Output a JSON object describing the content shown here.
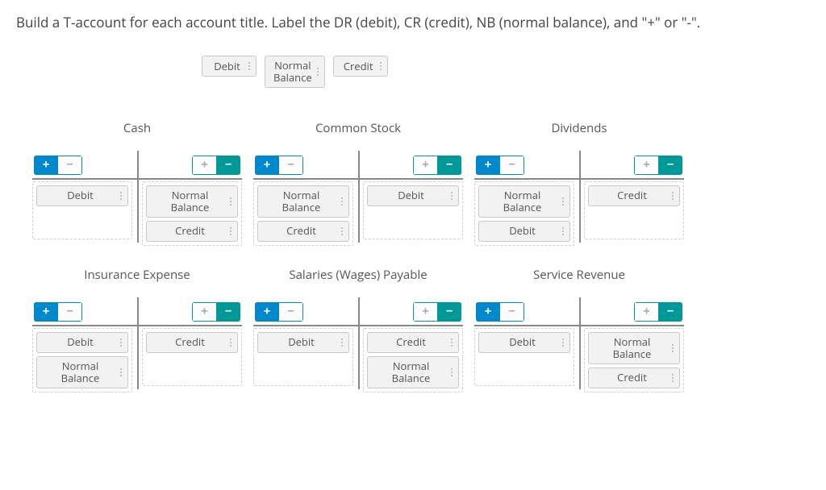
{
  "instruction": "Build a T-account for each account title. Label the DR (debit), CR (credit), NB (normal balance), and \"+\" or \"-\".",
  "pool": {
    "debit": "Debit",
    "normal_balance": "Normal\nBalance",
    "credit": "Credit"
  },
  "labels": {
    "debit": "Debit",
    "credit": "Credit",
    "normal_balance": "Normal\nBalance",
    "plus": "+",
    "minus": "−"
  },
  "accounts": [
    {
      "title": "Cash",
      "left": {
        "sign": "plus",
        "chips": [
          "debit"
        ]
      },
      "right": {
        "sign": "minus",
        "chips": [
          "normal_balance",
          "credit"
        ]
      }
    },
    {
      "title": "Common Stock",
      "left": {
        "sign": "plus",
        "chips": [
          "normal_balance",
          "credit"
        ]
      },
      "right": {
        "sign": "minus",
        "chips": [
          "debit"
        ]
      }
    },
    {
      "title": "Dividends",
      "left": {
        "sign": "plus",
        "chips": [
          "normal_balance",
          "debit"
        ]
      },
      "right": {
        "sign": "minus",
        "chips": [
          "credit"
        ]
      }
    },
    {
      "title": "Insurance Expense",
      "left": {
        "sign": "plus",
        "chips": [
          "debit",
          "normal_balance"
        ]
      },
      "right": {
        "sign": "minus",
        "chips": [
          "credit"
        ]
      }
    },
    {
      "title": "Salaries (Wages) Payable",
      "left": {
        "sign": "plus",
        "chips": [
          "debit"
        ]
      },
      "right": {
        "sign": "minus",
        "chips": [
          "credit",
          "normal_balance"
        ]
      }
    },
    {
      "title": "Service Revenue",
      "left": {
        "sign": "plus",
        "chips": [
          "debit"
        ]
      },
      "right": {
        "sign": "minus",
        "chips": [
          "normal_balance",
          "credit"
        ]
      }
    }
  ]
}
